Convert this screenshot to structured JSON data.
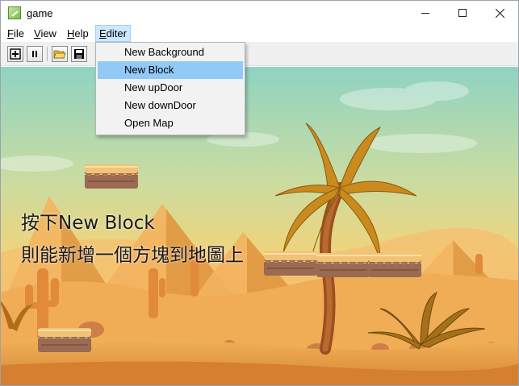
{
  "window": {
    "title": "game",
    "icon": "game-app-icon"
  },
  "menubar": {
    "items": [
      {
        "label": "File",
        "underline": "F"
      },
      {
        "label": "View",
        "underline": "V"
      },
      {
        "label": "Help",
        "underline": "H"
      },
      {
        "label": "Editer",
        "underline": "E",
        "active": true
      }
    ]
  },
  "toolbar": {
    "buttons": [
      {
        "icon": "add-icon"
      },
      {
        "icon": "pause-icon"
      },
      {
        "icon": "open-folder-icon"
      },
      {
        "icon": "save-icon"
      }
    ]
  },
  "editer_menu": {
    "items": [
      {
        "label": "New Background",
        "highlighted": false
      },
      {
        "label": "New Block",
        "highlighted": true
      },
      {
        "label": "New upDoor",
        "highlighted": false
      },
      {
        "label": "New downDoor",
        "highlighted": false
      },
      {
        "label": "Open Map",
        "highlighted": false
      }
    ]
  },
  "scene": {
    "caption_line1": "按下New Block",
    "caption_line2": "則能新增一個方塊到地圖上",
    "colors": {
      "sky_top": "#8fd3c3",
      "sky_mid": "#f2d37a",
      "sand": "#e7a14e",
      "platform_top": "#f2c277",
      "platform_side": "#9a6a52",
      "palm_leaf": "#c98a1e"
    }
  }
}
